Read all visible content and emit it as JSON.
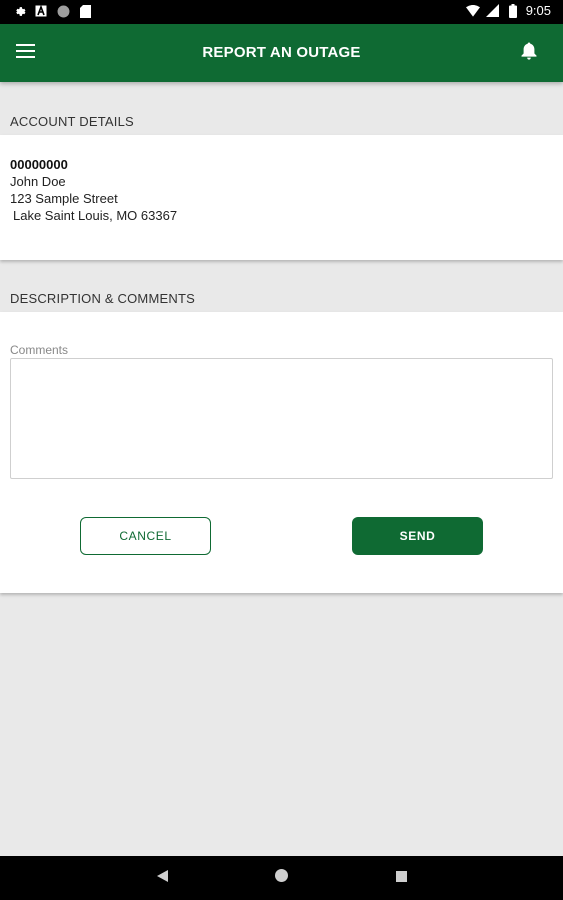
{
  "status_bar": {
    "time": "9:05",
    "left_icons": [
      "gear-icon",
      "a-notification-icon",
      "circle-icon",
      "sd-card-icon"
    ],
    "right_icons": [
      "wifi-icon",
      "signal-icon",
      "battery-icon"
    ]
  },
  "app_bar": {
    "title": "REPORT AN OUTAGE",
    "menu_icon": "hamburger-menu-icon",
    "bell_icon": "bell-icon"
  },
  "account_section": {
    "header": "ACCOUNT DETAILS",
    "account_number": "00000000",
    "name": "John Doe",
    "street": "123 Sample Street",
    "city_line": "Lake Saint Louis, MO 63367"
  },
  "comments_section": {
    "header": "DESCRIPTION & COMMENTS",
    "comments_label": "Comments",
    "comments_value": ""
  },
  "actions": {
    "cancel_label": "CANCEL",
    "send_label": "SEND"
  },
  "colors": {
    "primary": "#0f6a33",
    "background": "#e9e9e9"
  },
  "nav_bar": {
    "icons": [
      "back-icon",
      "home-icon",
      "recents-icon"
    ]
  }
}
